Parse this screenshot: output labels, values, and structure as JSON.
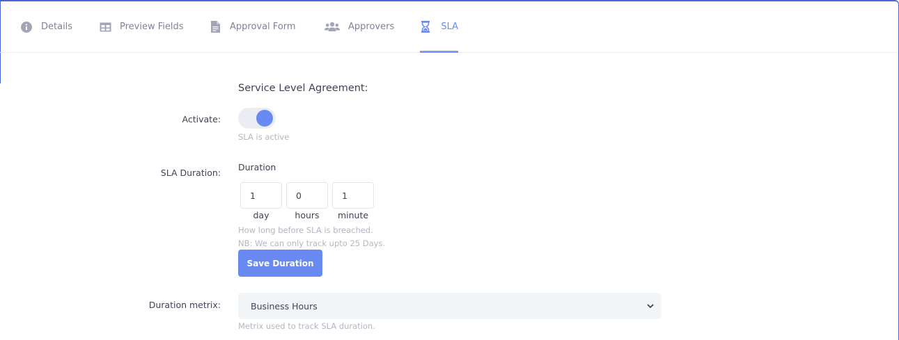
{
  "tabs": [
    {
      "label": "Details",
      "icon": "info-icon"
    },
    {
      "label": "Preview Fields",
      "icon": "table-icon"
    },
    {
      "label": "Approval Form",
      "icon": "document-icon"
    },
    {
      "label": "Approvers",
      "icon": "users-icon"
    },
    {
      "label": "SLA",
      "icon": "hourglass-icon",
      "active": true
    }
  ],
  "form": {
    "section_title": "Service Level Agreement:",
    "activate_label": "Activate:",
    "activate_state": true,
    "activate_help": "SLA is active",
    "sla_duration_label": "SLA Duration:",
    "duration_title": "Duration",
    "day_value": "1",
    "hours_value": "0",
    "minute_value": "1",
    "day_unit": "day",
    "hours_unit": "hours",
    "minute_unit": "minute",
    "duration_help_1": "How long before SLA is breached.",
    "duration_help_2": "NB: We can only track upto 25 Days.",
    "save_button": "Save Duration",
    "metrix_label": "Duration metrix:",
    "metrix_value": "Business Hours",
    "metrix_help": "Metrix used to track SLA duration."
  },
  "colors": {
    "accent": "#6a8af3",
    "frame": "#4b63d6",
    "muted_text": "#7e8299",
    "help_text": "#b5b5c3"
  }
}
